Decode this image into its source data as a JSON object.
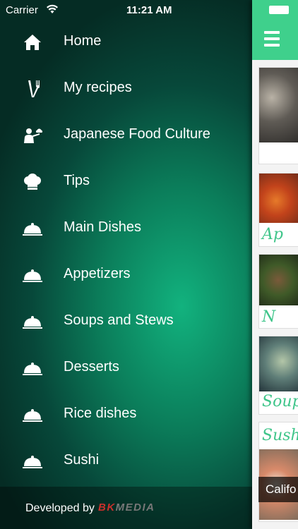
{
  "status": {
    "carrier": "Carrier",
    "time": "11:21 AM"
  },
  "menu": {
    "items": [
      {
        "label": "Home",
        "icon": "home-icon"
      },
      {
        "label": "My recipes",
        "icon": "fork-knife-icon"
      },
      {
        "label": "Japanese Food Culture",
        "icon": "waiter-icon"
      },
      {
        "label": "Tips",
        "icon": "chef-hat-icon"
      },
      {
        "label": "Main Dishes",
        "icon": "cloche-icon"
      },
      {
        "label": "Appetizers",
        "icon": "cloche-icon"
      },
      {
        "label": "Soups and Stews",
        "icon": "cloche-icon"
      },
      {
        "label": "Desserts",
        "icon": "cloche-icon"
      },
      {
        "label": "Rice dishes",
        "icon": "cloche-icon"
      },
      {
        "label": "Sushi",
        "icon": "cloche-icon"
      }
    ]
  },
  "footer": {
    "developed_by": "Developed by",
    "brand_a": "BK",
    "brand_b": "MEDIA"
  },
  "content": {
    "cards": [
      {
        "caption": ""
      },
      {
        "caption": "Ap"
      },
      {
        "caption": "N"
      },
      {
        "caption": "Soup"
      },
      {
        "caption": "Sush"
      }
    ],
    "overlay_label": "Califo"
  },
  "colors": {
    "accent": "#3fd08c",
    "caption": "#3fc58a"
  }
}
